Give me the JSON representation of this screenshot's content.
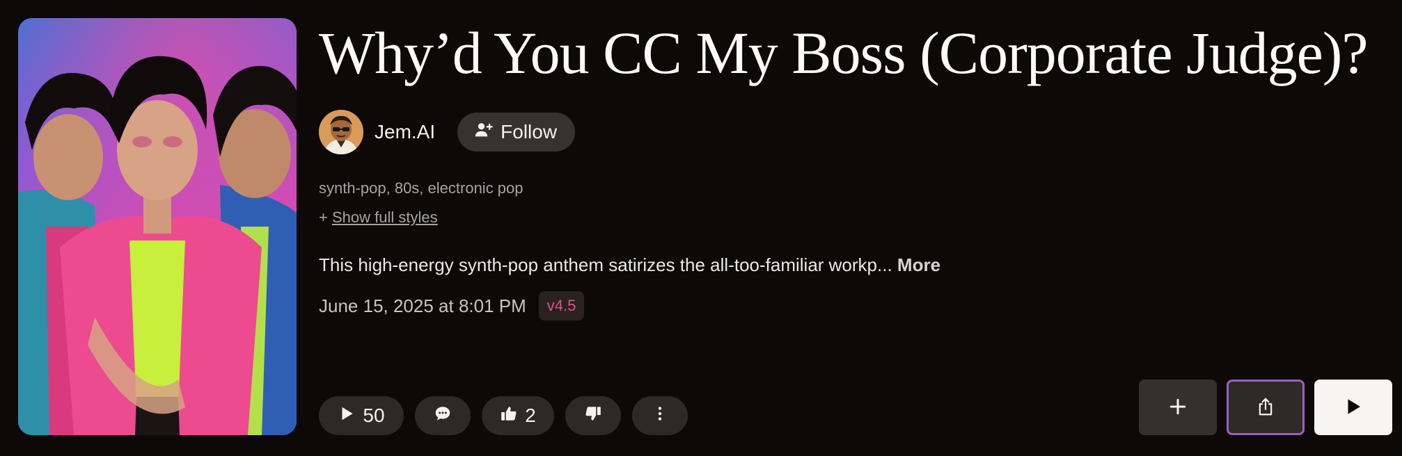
{
  "song": {
    "title": "Why’d You CC My Boss (Corporate Judge)?",
    "styles": "synth-pop, 80s, electronic pop",
    "show_styles_prefix": "+ ",
    "show_styles_label": "Show full styles",
    "description": "This high-energy synth-pop anthem satirizes the all-too-familiar workp...",
    "more_label": " More",
    "date": "June 15, 2025 at 8:01 PM",
    "version": "v4.5"
  },
  "artist": {
    "name": "Jem.AI",
    "follow_label": "Follow"
  },
  "stats": {
    "plays": "50",
    "likes": "2"
  },
  "icons": {
    "follow": "person-plus-icon",
    "play": "play-icon",
    "comment": "comment-icon",
    "like": "thumbs-up-icon",
    "dislike": "thumbs-down-icon",
    "more": "more-vertical-icon",
    "add": "plus-icon",
    "share": "share-icon"
  },
  "colors": {
    "background": "#0c0908",
    "version_badge_text": "#e0508c",
    "share_border": "#9b62b6",
    "play_button_bg": "#f7f4f2"
  }
}
